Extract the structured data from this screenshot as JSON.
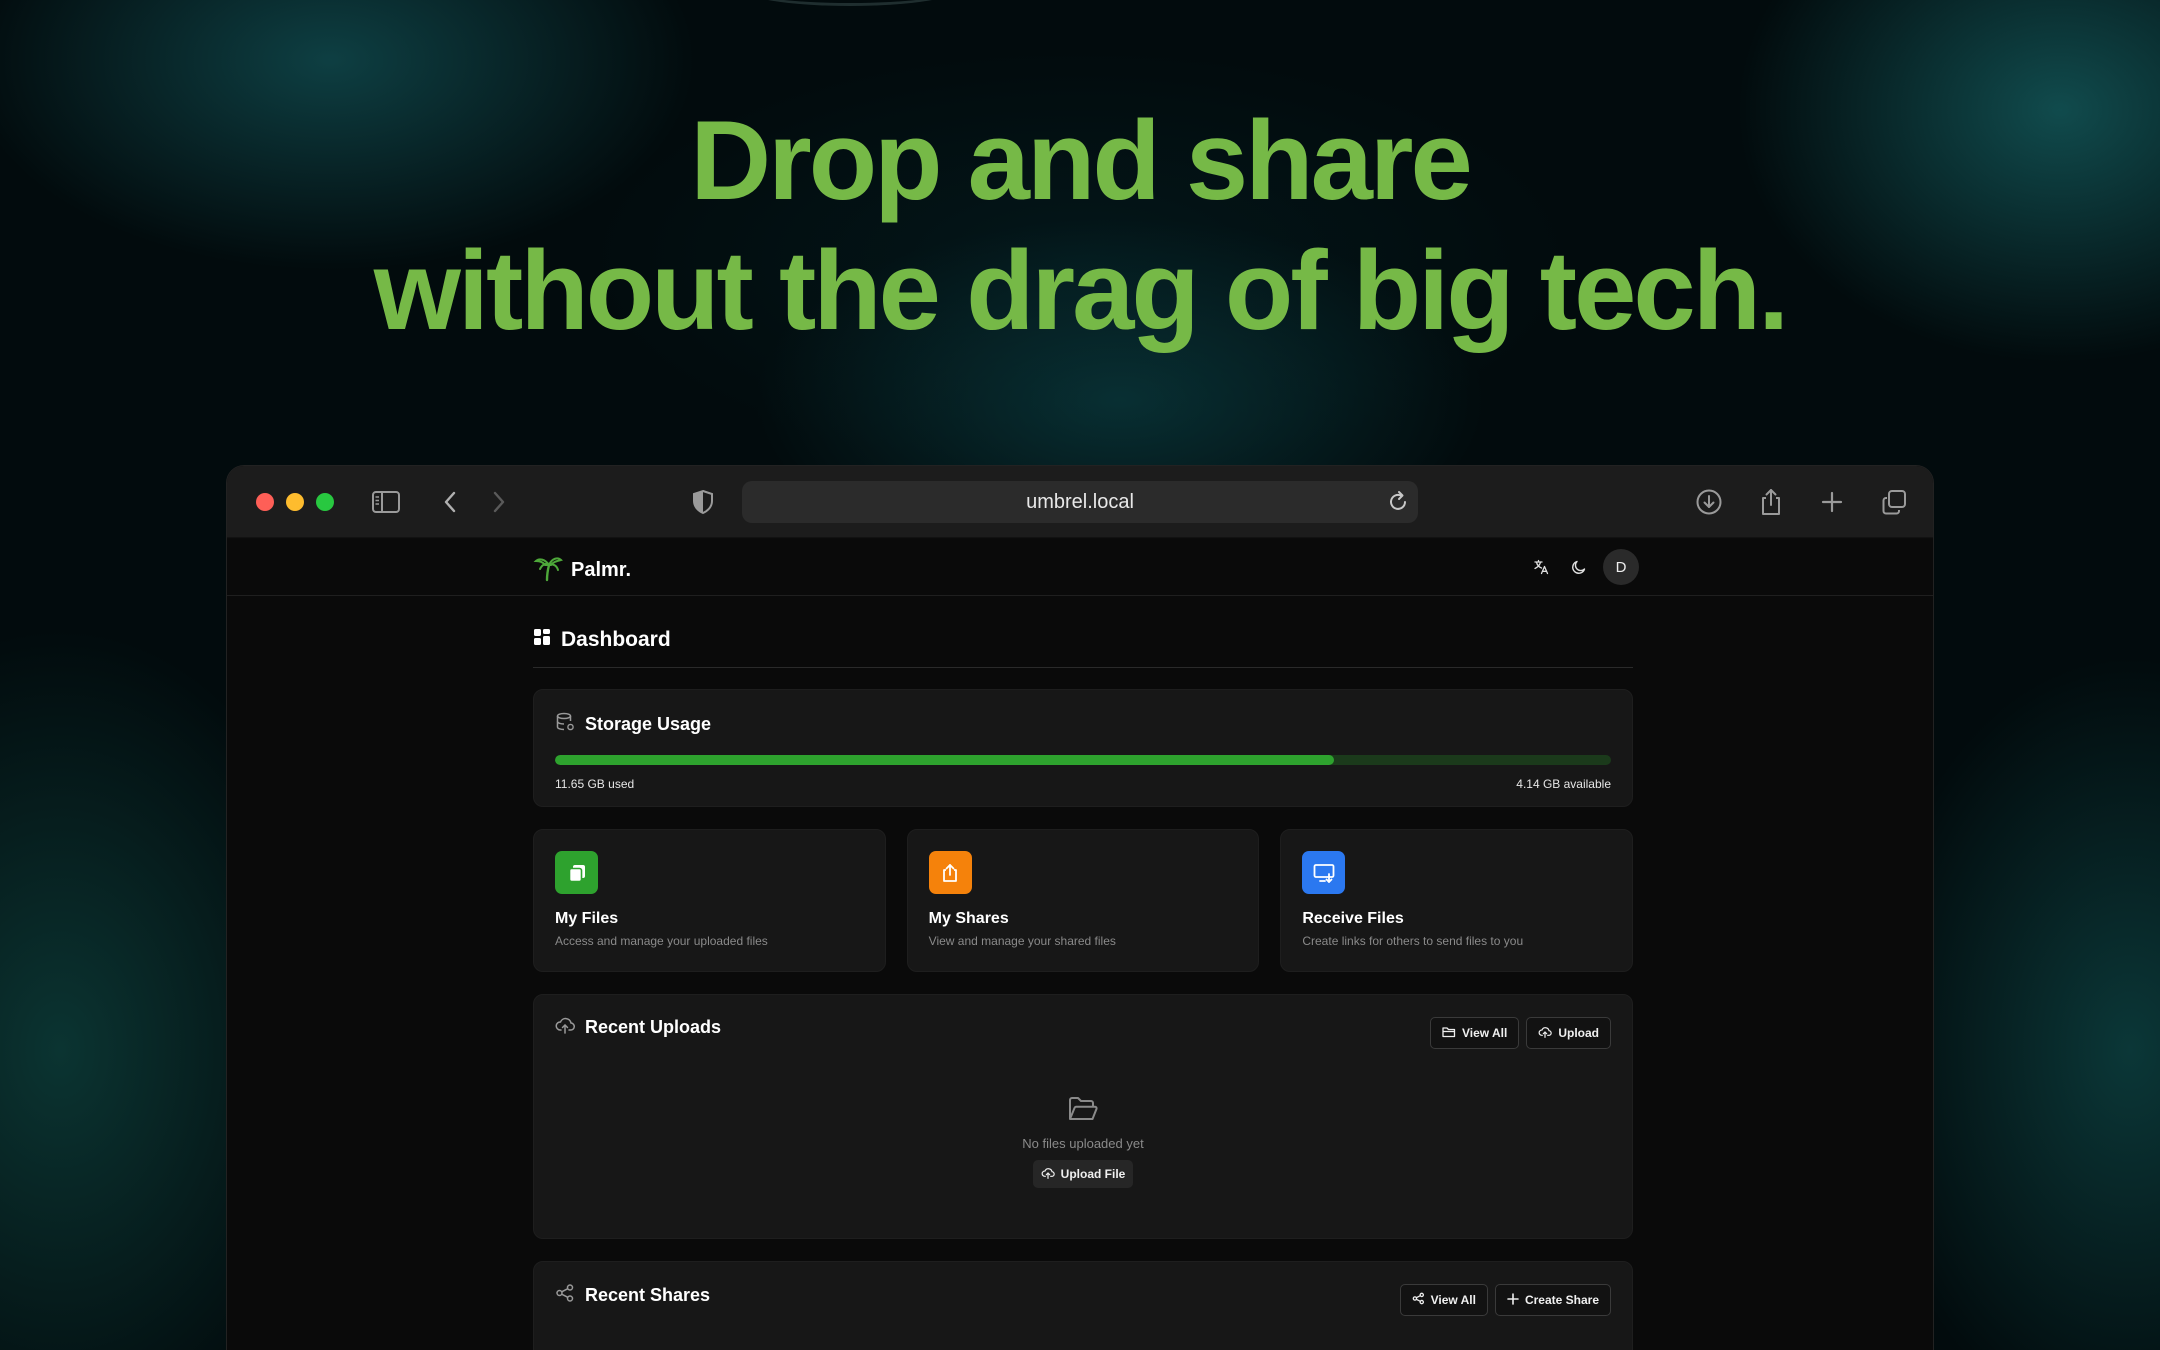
{
  "hero": {
    "line1": "Drop and share",
    "line2": "without the drag of big tech."
  },
  "browser": {
    "url": "umbrel.local"
  },
  "app": {
    "logo_text": "Palmr.",
    "avatar_initial": "D"
  },
  "dashboard": {
    "title": "Dashboard",
    "storage": {
      "title": "Storage Usage",
      "used_label": "11.65 GB used",
      "available_label": "4.14 GB available",
      "used_fraction": 0.738
    },
    "quick_actions": [
      {
        "title": "My Files",
        "description": "Access and manage your uploaded files",
        "color": "#2ea22e",
        "icon": "files-icon"
      },
      {
        "title": "My Shares",
        "description": "View and manage your shared files",
        "color": "#f5820b",
        "icon": "share-upload-icon"
      },
      {
        "title": "Receive Files",
        "description": "Create links for others to send files to you",
        "color": "#2b78f0",
        "icon": "receive-monitor-icon"
      }
    ],
    "recent_uploads": {
      "title": "Recent Uploads",
      "view_all": "View All",
      "upload": "Upload",
      "empty_text": "No files uploaded yet",
      "upload_file": "Upload File"
    },
    "recent_shares": {
      "title": "Recent Shares",
      "view_all": "View All",
      "create_share": "Create Share"
    }
  },
  "colors": {
    "hero_green": "#76b947",
    "bar_fill": "#2ea22e",
    "bar_track": "#1b3a1b"
  }
}
